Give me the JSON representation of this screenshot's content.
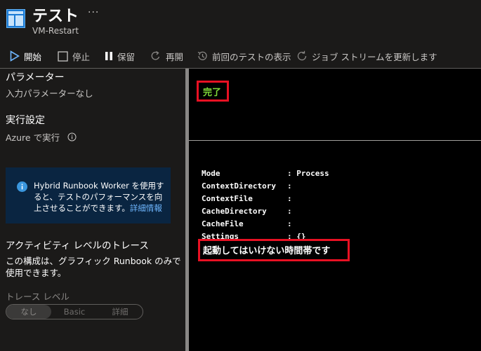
{
  "header": {
    "title": "テスト",
    "subtitle": "VM-Restart",
    "more_icon": "ellipsis-icon",
    "more_label": "···"
  },
  "toolbar": {
    "start": "開始",
    "stop": "停止",
    "suspend": "保留",
    "resume": "再開",
    "history": "前回のテストの表示",
    "refresh": "ジョブ ストリームを更新します"
  },
  "left_panel": {
    "params_heading": "パラメーター",
    "params_empty": "入力パラメーターなし",
    "run_heading": "実行設定",
    "run_on": "Azure で実行",
    "info_box": {
      "text": "Hybrid Runbook Worker を使用すると、テストのパフォーマンスを向上させることができます。",
      "link": "詳細情報"
    },
    "trace_heading": "アクティビティ レベルのトレース",
    "trace_desc": "この構成は、グラフィック Runbook のみで使用できます。",
    "trace_label": "トレース レベル",
    "trace_options": [
      "なし",
      "Basic",
      "詳細"
    ],
    "trace_selected": "なし"
  },
  "output_panel": {
    "status": "完了",
    "lines": [
      {
        "key": "Mode",
        "value": ": Process"
      },
      {
        "key": "ContextDirectory",
        "value": ":"
      },
      {
        "key": "ContextFile",
        "value": ":"
      },
      {
        "key": "CacheDirectory",
        "value": ":"
      },
      {
        "key": "CacheFile",
        "value": ":"
      },
      {
        "key": "Settings",
        "value": ": {}"
      }
    ],
    "message": "起動してはいけない時間帯です"
  },
  "colors": {
    "background": "#1b1a19",
    "output_background": "#000000",
    "status_green": "#7fd838",
    "highlight_red": "#e81123",
    "info_box": "#0a2541",
    "link": "#6fb7ff"
  }
}
